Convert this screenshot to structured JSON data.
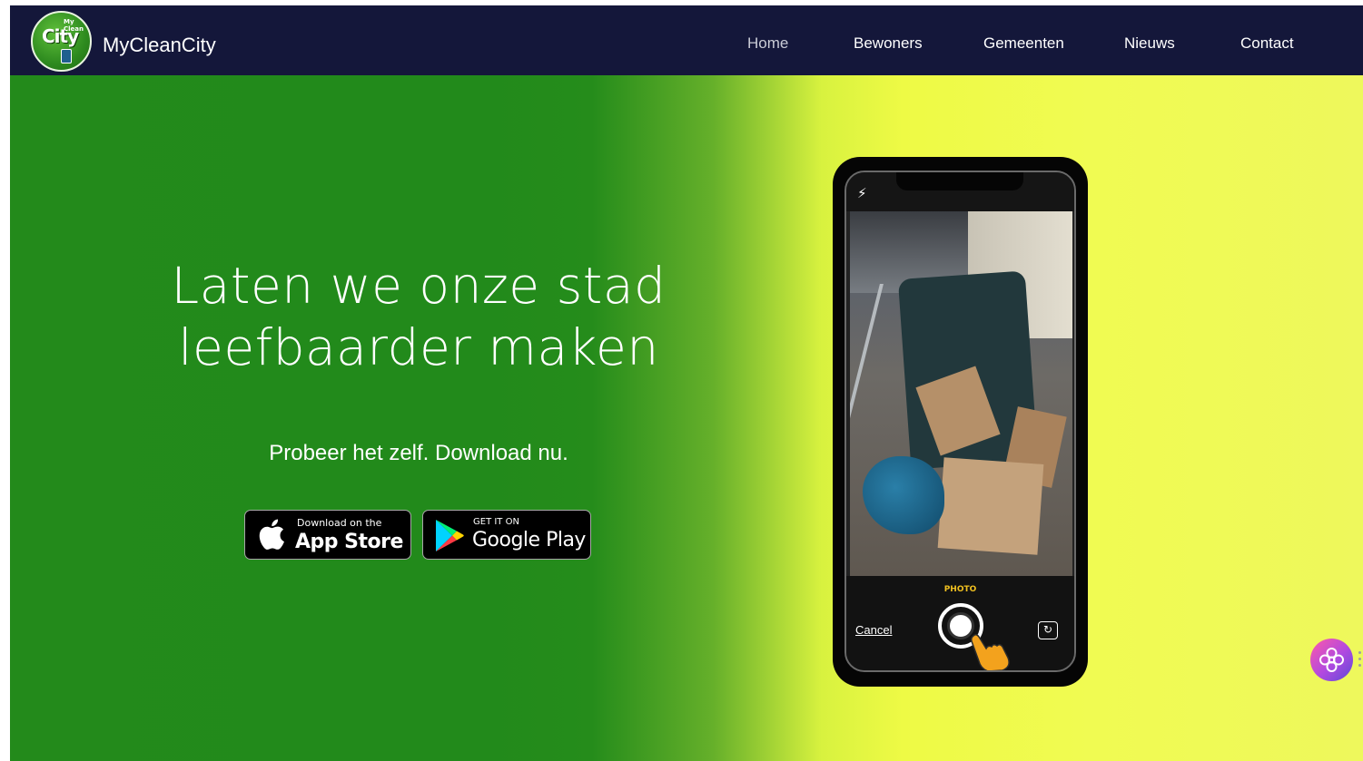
{
  "header": {
    "brand": "MyCleanCity",
    "logo_text": "City",
    "logo_small": "My Clean",
    "nav": [
      {
        "label": "Home",
        "active": true
      },
      {
        "label": "Bewoners",
        "active": false
      },
      {
        "label": "Gemeenten",
        "active": false
      },
      {
        "label": "Nieuws",
        "active": false
      },
      {
        "label": "Contact",
        "active": false
      }
    ]
  },
  "hero": {
    "headline_line1": "Laten we onze stad",
    "headline_line2": "leefbaarder maken",
    "subline": "Probeer het zelf. Download nu.",
    "app_store": {
      "small": "Download on the",
      "big": "App Store"
    },
    "google_play": {
      "small": "GET IT ON",
      "big": "Google Play"
    }
  },
  "phone": {
    "mode_label": "PHOTO",
    "cancel_label": "Cancel"
  },
  "colors": {
    "header_bg": "#14173a",
    "green": "#238a1b",
    "yellow": "#eefa45"
  },
  "icons": [
    "app-logo",
    "apple-icon",
    "google-play-icon",
    "flash-icon",
    "shutter-icon",
    "camera-flip-icon",
    "chat-widget-icon",
    "drag-handle-icon"
  ]
}
